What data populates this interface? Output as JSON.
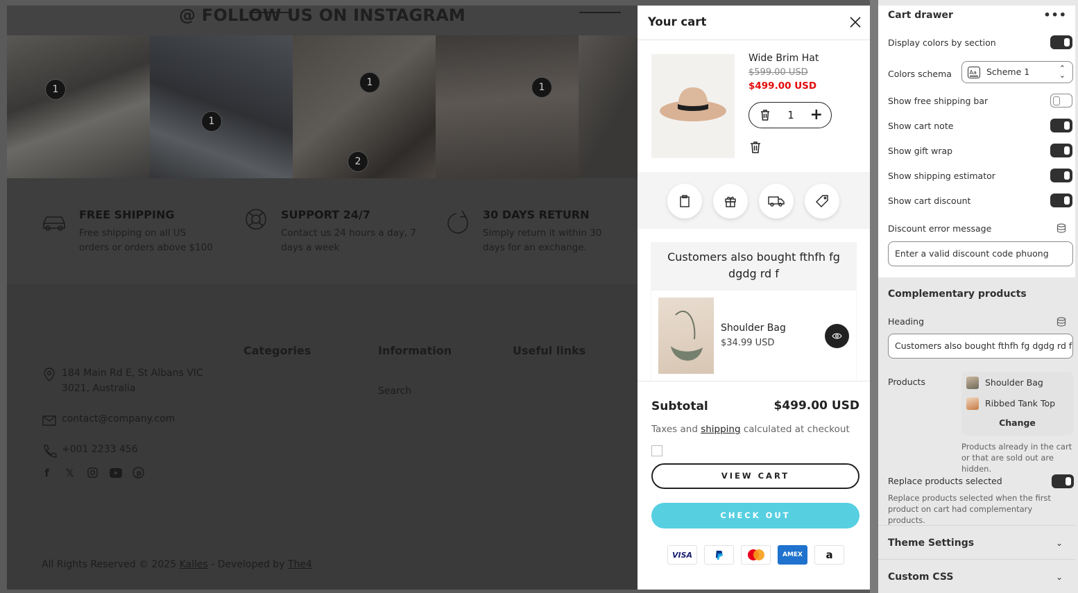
{
  "store": {
    "instagram_title": "@ FOLLOW US ON INSTAGRAM",
    "pins": [
      "1",
      "1",
      "1",
      "2",
      "1"
    ],
    "features": [
      {
        "icon": "car-icon",
        "title": "FREE SHIPPING",
        "text": "Free shipping on all US orders or orders above $100"
      },
      {
        "icon": "lifebuoy-icon",
        "title": "SUPPORT 24/7",
        "text": "Contact us 24 hours a day, 7 days a week"
      },
      {
        "icon": "refresh-icon",
        "title": "30 DAYS RETURN",
        "text": "Simply return it within 30 days for an exchange."
      }
    ],
    "footer": {
      "categories": "Categories",
      "information": "Information",
      "useful_links": "Useful links",
      "search_link": "Search",
      "address": "184 Main Rd E, St Albans VIC 3021, Australia",
      "email": "contact@company.com",
      "phone": "+001 2233 456",
      "copyright_prefix": "All Rights Reserved © 2025 ",
      "brand": "Kalles",
      "developed_by": " - Developed by ",
      "developer": "The4"
    }
  },
  "cart": {
    "title": "Your cart",
    "item": {
      "name": "Wide Brim Hat",
      "old_price": "$599.00 USD",
      "price": "$499.00 USD",
      "quantity": "1"
    },
    "upsell": {
      "heading": "Customers also bought fthfh fg dgdg rd f",
      "product_name": "Shoulder Bag",
      "product_price": "$34.99 USD"
    },
    "subtotal_label": "Subtotal",
    "subtotal_value": "$499.00 USD",
    "taxes_prefix": "Taxes and ",
    "taxes_link": "shipping",
    "taxes_suffix": " calculated at checkout",
    "view_cart": "VIEW CART",
    "checkout": "CHECK OUT",
    "payments": [
      "VISA",
      "PayPal",
      "Mastercard",
      "AMEX",
      "a"
    ]
  },
  "settings": {
    "panel_title": "Cart drawer",
    "display_colors": "Display colors by section",
    "colors_schema": "Colors schema",
    "scheme_value": "Scheme 1",
    "scheme_swatch": "Aa",
    "free_shipping": "Show free shipping bar",
    "cart_note": "Show cart note",
    "gift_wrap": "Show gift wrap",
    "shipping_estimator": "Show shipping estimator",
    "cart_discount": "Show cart discount",
    "discount_error_label": "Discount error message",
    "discount_error_value": "Enter a valid discount code phuong",
    "complementary_title": "Complementary products",
    "heading_label": "Heading",
    "heading_value": "Customers also bought fthfh  fg dgdg rd f",
    "products_label": "Products",
    "products": [
      "Shoulder Bag",
      "Ribbed Tank Top"
    ],
    "change": "Change",
    "products_help": "Products already in the cart or that are sold out are hidden.",
    "replace_label": "Replace products selected",
    "replace_help": "Replace products selected when the first product on cart had complementary products.",
    "theme_settings": "Theme Settings",
    "custom_css": "Custom CSS"
  },
  "colors": {
    "accent": "#56cfe1",
    "sale": "#e30b0b",
    "toggle_on": "#303030"
  }
}
